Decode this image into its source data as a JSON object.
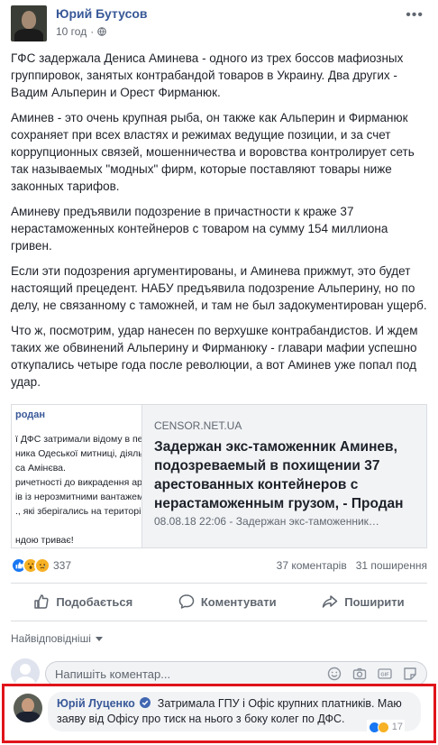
{
  "post": {
    "author": "Юрий Бутусов",
    "time": "10 год",
    "paragraphs": [
      "ГФС задержала Дениса Аминева - одного из трех боссов мафиозных группировок, занятых контрабандой товаров в Украину. Два других - Вадим Альперин и Орест Фирманюк.",
      "Аминев - это очень крупная рыба, он также как Альперин и Фирманюк сохраняет при всех властях и режимах ведущие позиции, и за счет коррупционных связей, мошенничества и воровства контролирует сеть так называемых \"модных\" фирм, которые поставляют товары ниже законных тарифов.",
      "Аминеву предъявили подозрение в причастности к краже 37 нерастаможенных контейнеров с товаром на сумму 154 миллиона гривен.",
      "Если эти подозрения аргументированы, и Аминева прижмут, это будет настоящий прецедент. НАБУ предъявила подозрение Альперину, но по делу, не связанному с таможней, и там не был задокументирован ущерб.",
      "Что ж, посмотрим, удар нанесен по верхушке контрабандистов. И ждем таких же обвинений Альперину и Фирманюку - главари мафии успешно откупались четыре года после революции, а вот Аминев уже попал под удар."
    ]
  },
  "link": {
    "thumb_title": "родан",
    "thumb_lines": [
      "ї ДФС затримали відому в певн",
      "ника Одеської митниці, діяльніст",
      "са Амінєва.",
      "ричетності до викрадення ареш",
      "ів із нерозмитними вантажем с",
      "., які зберігались на територі М",
      "",
      "ндою триває!"
    ],
    "domain": "CENSOR.NET.UA",
    "title": "Задержан экс-таможенник Аминев, подозреваемый в похищении 37 арестованных контейнеров с нерастаможенным грузом, - Продан",
    "desc": "08.08.18 22:06 - Задержан экс-таможенник…"
  },
  "stats": {
    "reactions_count": "337",
    "comments": "37 коментарів",
    "shares": "31 поширення"
  },
  "actions": {
    "like": "Подобається",
    "comment": "Коментувати",
    "share": "Поширити"
  },
  "sort": {
    "label": "Найвідповідніші"
  },
  "composer": {
    "placeholder": "Напишіть коментар..."
  },
  "comment": {
    "author": "Юрій Луценко",
    "text": "Затримала ГПУ і Офіс крупних платників. Маю заяву від Офісу про тиск на нього з боку колег по ДФС.",
    "reactions_count": "17"
  },
  "colors": {
    "link_blue": "#385898",
    "like_blue": "#1877f2",
    "highlight_red": "#e0141a"
  }
}
